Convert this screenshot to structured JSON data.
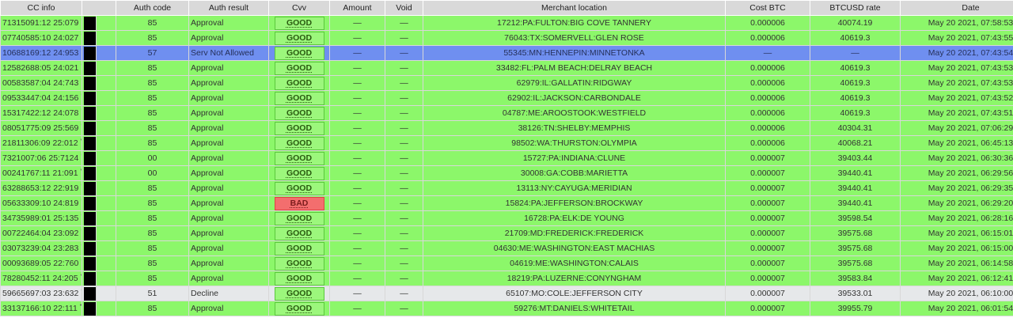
{
  "headers": {
    "cc_info": "CC info",
    "auth_code": "Auth code",
    "auth_result": "Auth result",
    "cvv": "Cvv",
    "amount": "Amount",
    "void": "Void",
    "merchant_location": "Merchant location",
    "cost_btc": "Cost BTC",
    "btcusd_rate": "BTCUSD rate",
    "date": "Date"
  },
  "colors": {
    "approved": "#8cf76a",
    "not_allowed": "#6f8ff0",
    "decline": "#e6e8ea",
    "bad": "#f36e6e",
    "good": "#9cf77c"
  },
  "rows": [
    {
      "cc": "71315091:12 25:079",
      "auth_code": "85",
      "auth_result": "Approval",
      "cvv": "GOOD",
      "amount": "—",
      "void": "—",
      "merchant": "17212:PA:FULTON:BIG COVE TANNERY",
      "cost": "0.000006",
      "rate": "40074.19",
      "date": "May 20 2021, 07:58:53",
      "style": "green",
      "cvv_status": "good"
    },
    {
      "cc": "07740585:10 24:027",
      "auth_code": "85",
      "auth_result": "Approval",
      "cvv": "GOOD",
      "amount": "—",
      "void": "—",
      "merchant": "76043:TX:SOMERVELL:GLEN ROSE",
      "cost": "0.000006",
      "rate": "40619.3",
      "date": "May 20 2021, 07:43:55",
      "style": "green",
      "cvv_status": "good"
    },
    {
      "cc": "10688169:12 24:953",
      "auth_code": "57",
      "auth_result": "Serv Not Allowed",
      "cvv": "GOOD",
      "amount": "—",
      "void": "—",
      "merchant": "55345:MN:HENNEPIN:MINNETONKA",
      "cost": "—",
      "rate": "—",
      "date": "May 20 2021, 07:43:54",
      "style": "blue",
      "cvv_status": "good"
    },
    {
      "cc": "12582688:05 24:021",
      "auth_code": "85",
      "auth_result": "Approval",
      "cvv": "GOOD",
      "amount": "—",
      "void": "—",
      "merchant": "33482:FL:PALM BEACH:DELRAY BEACH",
      "cost": "0.000006",
      "rate": "40619.3",
      "date": "May 20 2021, 07:43:53",
      "style": "green",
      "cvv_status": "good"
    },
    {
      "cc": "00583587:04 24:743",
      "auth_code": "85",
      "auth_result": "Approval",
      "cvv": "GOOD",
      "amount": "—",
      "void": "—",
      "merchant": "62979:IL:GALLATIN:RIDGWAY",
      "cost": "0.000006",
      "rate": "40619.3",
      "date": "May 20 2021, 07:43:53",
      "style": "green",
      "cvv_status": "good"
    },
    {
      "cc": "09533447:04 24:156",
      "auth_code": "85",
      "auth_result": "Approval",
      "cvv": "GOOD",
      "amount": "—",
      "void": "—",
      "merchant": "62902:IL:JACKSON:CARBONDALE",
      "cost": "0.000006",
      "rate": "40619.3",
      "date": "May 20 2021, 07:43:52",
      "style": "green",
      "cvv_status": "good"
    },
    {
      "cc": "15317422:12 24:078",
      "auth_code": "85",
      "auth_result": "Approval",
      "cvv": "GOOD",
      "amount": "—",
      "void": "—",
      "merchant": "04787:ME:AROOSTOOK:WESTFIELD",
      "cost": "0.000006",
      "rate": "40619.3",
      "date": "May 20 2021, 07:43:51",
      "style": "green",
      "cvv_status": "good"
    },
    {
      "cc": "08051775:09 25:569",
      "auth_code": "85",
      "auth_result": "Approval",
      "cvv": "GOOD",
      "amount": "—",
      "void": "—",
      "merchant": "38126:TN:SHELBY:MEMPHIS",
      "cost": "0.000006",
      "rate": "40304.31",
      "date": "May 20 2021, 07:06:29",
      "style": "green",
      "cvv_status": "good"
    },
    {
      "cc": "21811306:09 22:012",
      "auth_code": "85",
      "auth_result": "Approval",
      "cvv": "GOOD",
      "amount": "—",
      "void": "—",
      "merchant": "98502:WA:THURSTON:OLYMPIA",
      "cost": "0.000006",
      "rate": "40068.21",
      "date": "May 20 2021, 06:45:13",
      "style": "green",
      "cvv_status": "good"
    },
    {
      "cc": "7321007:06 25:7124",
      "auth_code": "00",
      "auth_result": "Approval",
      "cvv": "GOOD",
      "amount": "—",
      "void": "—",
      "merchant": "15727:PA:INDIANA:CLUNE",
      "cost": "0.000007",
      "rate": "39403.44",
      "date": "May 20 2021, 06:30:36",
      "style": "green",
      "cvv_status": "good"
    },
    {
      "cc": "00241767:11 21:091",
      "auth_code": "00",
      "auth_result": "Approval",
      "cvv": "GOOD",
      "amount": "—",
      "void": "—",
      "merchant": "30008:GA:COBB:MARIETTA",
      "cost": "0.000007",
      "rate": "39440.41",
      "date": "May 20 2021, 06:29:56",
      "style": "green",
      "cvv_status": "good"
    },
    {
      "cc": "63288653:12 22:919",
      "auth_code": "85",
      "auth_result": "Approval",
      "cvv": "GOOD",
      "amount": "—",
      "void": "—",
      "merchant": "13113:NY:CAYUGA:MERIDIAN",
      "cost": "0.000007",
      "rate": "39440.41",
      "date": "May 20 2021, 06:29:35",
      "style": "green",
      "cvv_status": "good"
    },
    {
      "cc": "05633309:10 24:819",
      "auth_code": "85",
      "auth_result": "Approval",
      "cvv": "BAD",
      "amount": "—",
      "void": "—",
      "merchant": "15824:PA:JEFFERSON:BROCKWAY",
      "cost": "0.000007",
      "rate": "39440.41",
      "date": "May 20 2021, 06:29:20",
      "style": "green",
      "cvv_status": "bad"
    },
    {
      "cc": "34735989:01 25:135",
      "auth_code": "85",
      "auth_result": "Approval",
      "cvv": "GOOD",
      "amount": "—",
      "void": "—",
      "merchant": "16728:PA:ELK:DE YOUNG",
      "cost": "0.000007",
      "rate": "39598.54",
      "date": "May 20 2021, 06:28:16",
      "style": "green",
      "cvv_status": "good"
    },
    {
      "cc": "00722464:04 23:092",
      "auth_code": "85",
      "auth_result": "Approval",
      "cvv": "GOOD",
      "amount": "—",
      "void": "—",
      "merchant": "21709:MD:FREDERICK:FREDERICK",
      "cost": "0.000007",
      "rate": "39575.68",
      "date": "May 20 2021, 06:15:01",
      "style": "green",
      "cvv_status": "good"
    },
    {
      "cc": "03073239:04 23:283",
      "auth_code": "85",
      "auth_result": "Approval",
      "cvv": "GOOD",
      "amount": "—",
      "void": "—",
      "merchant": "04630:ME:WASHINGTON:EAST MACHIAS",
      "cost": "0.000007",
      "rate": "39575.68",
      "date": "May 20 2021, 06:15:00",
      "style": "green",
      "cvv_status": "good"
    },
    {
      "cc": "00093689:05 22:760",
      "auth_code": "85",
      "auth_result": "Approval",
      "cvv": "GOOD",
      "amount": "—",
      "void": "—",
      "merchant": "04619:ME:WASHINGTON:CALAIS",
      "cost": "0.000007",
      "rate": "39575.68",
      "date": "May 20 2021, 06:14:58",
      "style": "green",
      "cvv_status": "good"
    },
    {
      "cc": "78280452:11 24:205",
      "auth_code": "85",
      "auth_result": "Approval",
      "cvv": "GOOD",
      "amount": "—",
      "void": "—",
      "merchant": "18219:PA:LUZERNE:CONYNGHAM",
      "cost": "0.000007",
      "rate": "39583.84",
      "date": "May 20 2021, 06:12:41",
      "style": "green",
      "cvv_status": "good"
    },
    {
      "cc": "59665697:03 23:632",
      "auth_code": "51",
      "auth_result": "Decline",
      "cvv": "GOOD",
      "amount": "—",
      "void": "—",
      "merchant": "65107:MO:COLE:JEFFERSON CITY",
      "cost": "0.000007",
      "rate": "39533.01",
      "date": "May 20 2021, 06:10:00",
      "style": "grey",
      "cvv_status": "good"
    },
    {
      "cc": "33137166:10 22:111",
      "auth_code": "85",
      "auth_result": "Approval",
      "cvv": "GOOD",
      "amount": "—",
      "void": "—",
      "merchant": "59276:MT:DANIELS:WHITETAIL",
      "cost": "0.000007",
      "rate": "39955.79",
      "date": "May 20 2021, 06:01:54",
      "style": "green",
      "cvv_status": "good"
    }
  ]
}
